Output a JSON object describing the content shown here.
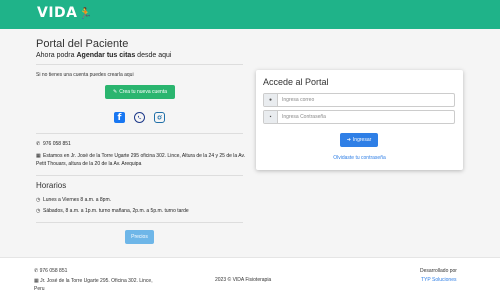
{
  "header": {
    "logo_text": "VIDA",
    "brand_color": "#1fb389",
    "logo_icon": "running-figure-icon"
  },
  "portal": {
    "title": "Portal del Paciente",
    "subtitle_prefix": "Ahora podra ",
    "subtitle_bold": "Agendar tus citas",
    "subtitle_suffix": " desde aqui"
  },
  "signup": {
    "prompt": "Si no tienes una cuenta puedes crearla aqui",
    "create_button": "Crea tu nueva cuenta",
    "create_icon": "pencil-icon"
  },
  "social": {
    "facebook_icon": "facebook-icon",
    "whatsapp_icon": "whatsapp-icon",
    "instagram_icon": "instagram-icon"
  },
  "contact": {
    "phone": "976 058 851",
    "address": "Estamos en Jr. José de la Torre Ugarte 295 oficina 302. Lince, Altura de la 24 y 25 de la Av. Petit Thouars, altura de la 20 de la Av. Arequipa"
  },
  "horarios": {
    "title": "Horarios",
    "line1": "Lunes a Viernes 8 a.m. a 8pm.",
    "line2": "Sábados, 8 a.m. a 1p.m. turno mañana, 2p.m. a 5p.m. turno tarde"
  },
  "precios_button": "Precios",
  "login": {
    "title": "Accede al Portal",
    "email_placeholder": "Ingresa correo",
    "password_placeholder": "Ingresa Contraseña",
    "submit_label": "Ingresar",
    "forgot_label": "Olvidaste tu contraseña",
    "accent": "#2f7fe6"
  },
  "footer": {
    "phone": "976 058 851",
    "address_line1": "Jr. José de la Torre Ugarte 295. Oficina 302. Lince,",
    "address_line2": "Peru",
    "copyright": "2023 © VIDA Fisioterapia",
    "developed_by": "Desarrollado por",
    "developer": "TYP Soluciones"
  }
}
